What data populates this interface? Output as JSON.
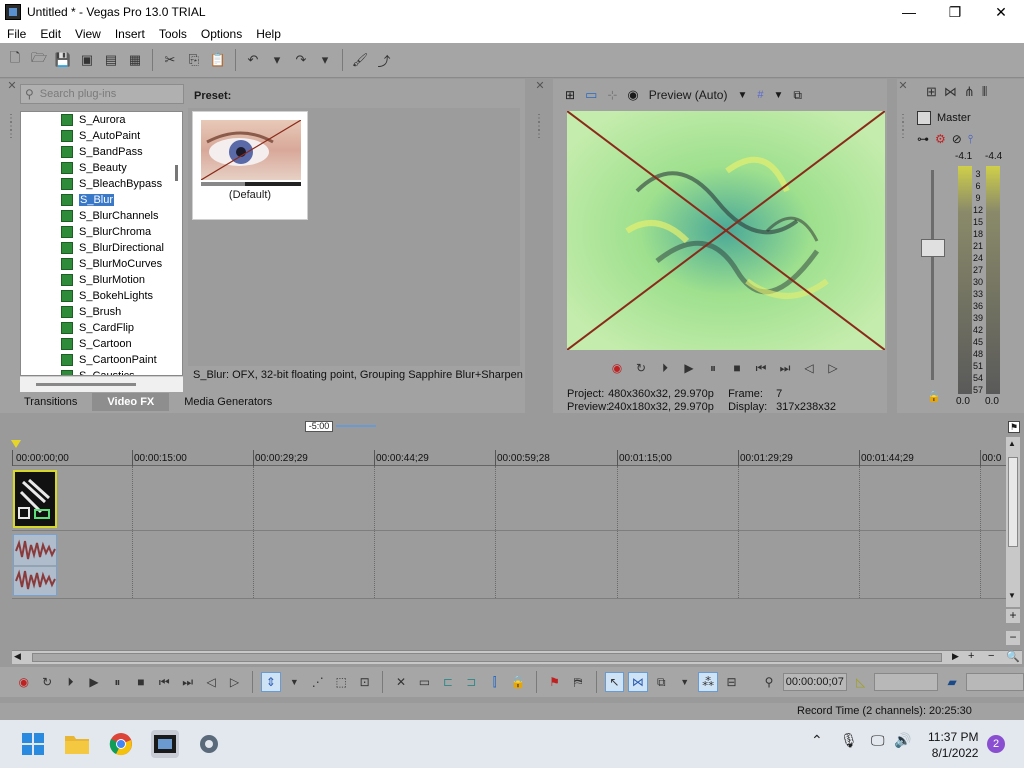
{
  "window": {
    "title": "Untitled * - Vegas Pro 13.0 TRIAL",
    "minimize": "—",
    "maximize": "❐",
    "close": "✕"
  },
  "menu": [
    "File",
    "Edit",
    "View",
    "Insert",
    "Tools",
    "Options",
    "Help"
  ],
  "plugins": {
    "search_placeholder": "Search plug-ins",
    "items": [
      "S_Aurora",
      "S_AutoPaint",
      "S_BandPass",
      "S_Beauty",
      "S_BleachBypass",
      "S_Blur",
      "S_BlurChannels",
      "S_BlurChroma",
      "S_BlurDirectional",
      "S_BlurMoCurves",
      "S_BlurMotion",
      "S_BokehLights",
      "S_Brush",
      "S_CardFlip",
      "S_Cartoon",
      "S_CartoonPaint",
      "S_Caustics"
    ],
    "selected": "S_Blur",
    "preset_label": "Preset:",
    "preset_name": "(Default)",
    "description": "S_Blur: OFX, 32-bit floating point, Grouping  Sapphire Blur+Sharpen"
  },
  "tabs": [
    "Transitions",
    "Video FX",
    "Media Generators"
  ],
  "active_tab": "Video FX",
  "preview": {
    "mode_label": "Preview (Auto)",
    "project_label": "Project:",
    "project_value": "480x360x32, 29.970p",
    "preview_label": "Preview:",
    "preview_value": "240x180x32, 29.970p",
    "frame_label": "Frame:",
    "frame_value": "7",
    "display_label": "Display:",
    "display_value": "317x238x32"
  },
  "master": {
    "title": "Master",
    "peak_left": "-4.1",
    "peak_right": "-4.4",
    "scale": [
      "3",
      "6",
      "9",
      "12",
      "15",
      "18",
      "21",
      "24",
      "27",
      "30",
      "33",
      "36",
      "39",
      "42",
      "45",
      "48",
      "51",
      "54",
      "57"
    ],
    "bottom_left": "0.0",
    "bottom_right": "0.0"
  },
  "timeline": {
    "zoom": "-5:00",
    "ruler": [
      "00:00:00;00",
      "00:00:15:00",
      "00:00:29;29",
      "00:00:44;29",
      "00:00:59;28",
      "00:01:15;00",
      "00:01:29;29",
      "00:01:44;29",
      "00:0"
    ]
  },
  "transport": {
    "time": "00:00:00;07"
  },
  "status": {
    "record_time": "Record Time (2 channels): 20:25:30"
  },
  "taskbar": {
    "time": "11:37 PM",
    "date": "8/1/2022",
    "notifications": "2"
  },
  "colors": {
    "selection": "#3a78c8",
    "clip_border": "#d7d727",
    "preview_green": "#9ee08e",
    "x_line": "#8b2a1a"
  }
}
